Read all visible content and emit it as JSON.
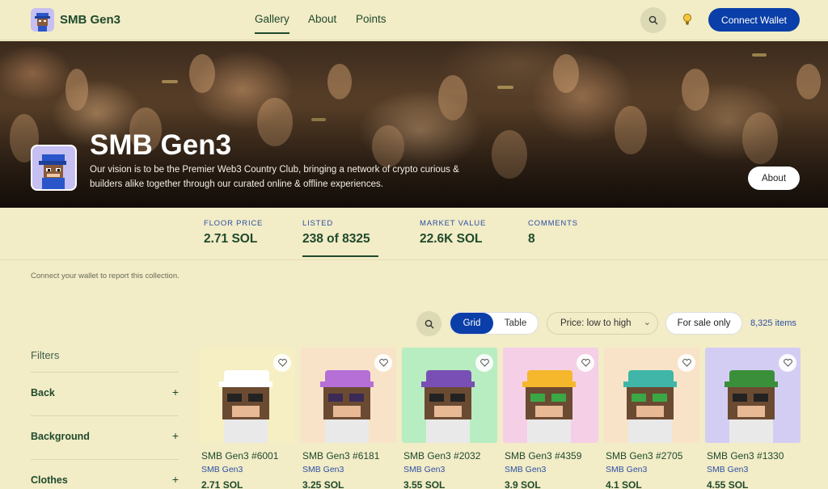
{
  "header": {
    "brand": "SMB Gen3",
    "nav": [
      {
        "label": "Gallery",
        "active": true
      },
      {
        "label": "About",
        "active": false
      },
      {
        "label": "Points",
        "active": false
      }
    ],
    "connect_wallet": "Connect Wallet",
    "icons": [
      "search-icon",
      "lightbulb-icon"
    ]
  },
  "banner": {
    "title": "SMB Gen3",
    "description": "Our vision is to be the Premier Web3 Country Club, bringing a network of crypto curious & builders alike together through our curated online & offline experiences.",
    "about_button": "About"
  },
  "stats": [
    {
      "label": "FLOOR PRICE",
      "value": "2.71 SOL",
      "active": false
    },
    {
      "label": "LISTED",
      "value": "238 of 8325",
      "active": true
    },
    {
      "label": "MARKET VALUE",
      "value": "22.6K SOL",
      "active": false
    },
    {
      "label": "COMMENTS",
      "value": "8",
      "active": false
    }
  ],
  "report_text": "Connect your wallet to report this collection.",
  "toolbar": {
    "view_grid": "Grid",
    "view_table": "Table",
    "sort_selected": "Price: low to high",
    "sale_filter": "For sale only",
    "item_count": "8,325 items"
  },
  "filters": {
    "heading": "Filters",
    "items": [
      {
        "label": "Back"
      },
      {
        "label": "Background"
      },
      {
        "label": "Clothes"
      }
    ]
  },
  "cards": [
    {
      "name": "SMB Gen3 #6001",
      "collection": "SMB Gen3",
      "price": "2.71 SOL",
      "bg": "#f6efc4",
      "hat": "#ffffff",
      "eyes": "#222222"
    },
    {
      "name": "SMB Gen3 #6181",
      "collection": "SMB Gen3",
      "price": "3.25 SOL",
      "bg": "#f8e3c8",
      "hat": "#b56fd6",
      "eyes": "#3b2a55"
    },
    {
      "name": "SMB Gen3 #2032",
      "collection": "SMB Gen3",
      "price": "3.55 SOL",
      "bg": "#b8ecc1",
      "hat": "#7a4fb5",
      "eyes": "#222222"
    },
    {
      "name": "SMB Gen3 #4359",
      "collection": "SMB Gen3",
      "price": "3.9 SOL",
      "bg": "#f5cfe6",
      "hat": "#f5b72b",
      "eyes": "#3aa845"
    },
    {
      "name": "SMB Gen3 #2705",
      "collection": "SMB Gen3",
      "price": "4.1 SOL",
      "bg": "#f8e3c8",
      "hat": "#3fb6a8",
      "eyes": "#3aa845"
    },
    {
      "name": "SMB Gen3 #1330",
      "collection": "SMB Gen3",
      "price": "4.55 SOL",
      "bg": "#d4cdf3",
      "hat": "#3a8f3a",
      "eyes": "#222222"
    }
  ]
}
